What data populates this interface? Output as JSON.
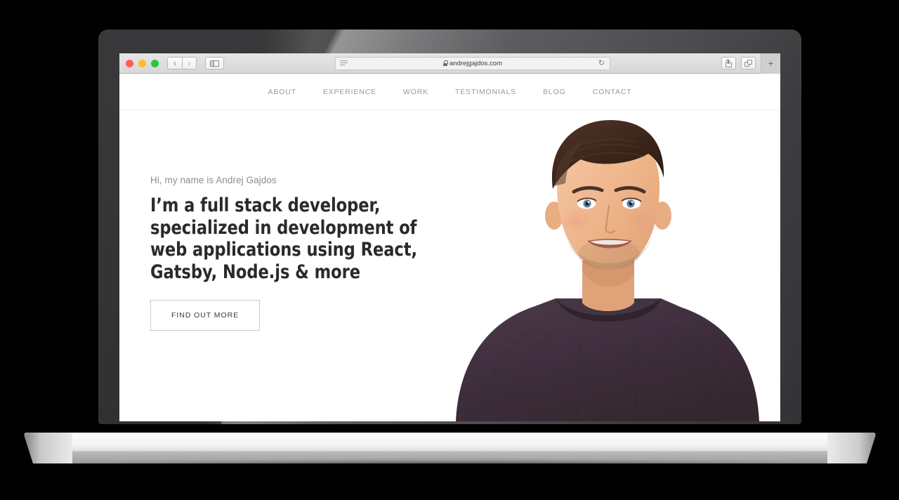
{
  "device": {
    "type": "laptop-mockup",
    "bezel_color": "#3a3a3c",
    "base_color": "#f3f3f3"
  },
  "browser": {
    "traffic_lights": [
      {
        "name": "close",
        "color": "#ff5f57"
      },
      {
        "name": "minimize",
        "color": "#febc2e"
      },
      {
        "name": "zoom",
        "color": "#28c840"
      }
    ],
    "back_label": "‹",
    "forward_label": "›",
    "sidebar_icon": "sidebar-icon",
    "reader_icon": "reader-view-icon",
    "address": "andrejgajdos.com",
    "secure_icon": "lock-icon",
    "reload_label": "↻",
    "share_icon": "share-icon",
    "tabs_icon": "show-tabs-icon",
    "newtab_label": "+"
  },
  "site": {
    "nav": [
      {
        "id": "about",
        "label": "ABOUT"
      },
      {
        "id": "experience",
        "label": "EXPERIENCE"
      },
      {
        "id": "work",
        "label": "WORK"
      },
      {
        "id": "testimonials",
        "label": "TESTIMONIALS"
      },
      {
        "id": "blog",
        "label": "BLOG"
      },
      {
        "id": "contact",
        "label": "CONTACT"
      }
    ],
    "hero": {
      "eyebrow": "Hi, my name is Andrej Gajdos",
      "title": "I’m a full stack developer, specialized in development of web applications using React, Gatsby, Node.js & more",
      "cta_label": "FIND OUT MORE",
      "portrait_alt": "Portrait photo of Andrej Gajdos",
      "eyebrow_color": "#8c8c92",
      "title_color": "#2a2a2a",
      "nav_color": "#9a9a9a"
    }
  }
}
